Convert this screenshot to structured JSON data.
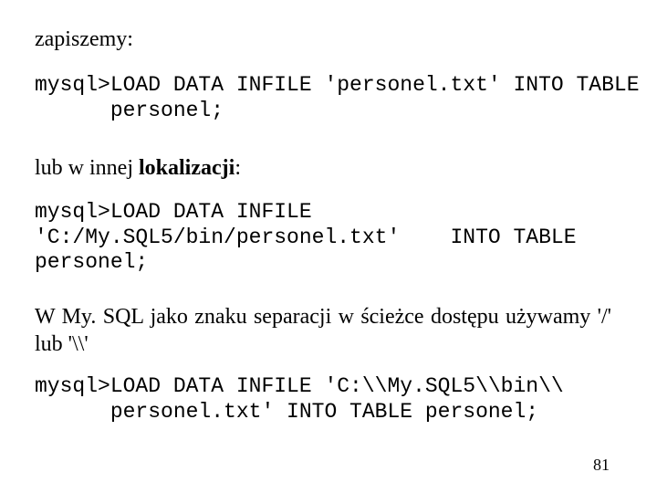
{
  "para1": "zapiszemy:",
  "code1": "mysql>LOAD DATA INFILE 'personel.txt' INTO TABLE\n      personel;",
  "para2_pre": "lub w innej ",
  "para2_bold": "lokalizacji",
  "para2_post": ":",
  "code2": "mysql>LOAD DATA INFILE\n'C:/My.SQL5/bin/personel.txt'    INTO TABLE\npersonel;",
  "para3": "W My. SQL jako znaku separacji w ścieżce dostępu używamy '/' lub '\\\\'",
  "code3": "mysql>LOAD DATA INFILE 'C:\\\\My.SQL5\\\\bin\\\\\n      personel.txt' INTO TABLE personel;",
  "page_number": "81"
}
